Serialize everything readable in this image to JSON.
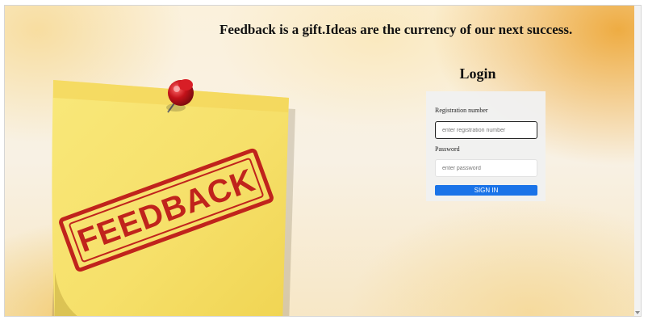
{
  "header": {
    "headline": "Feedback is a gift.Ideas are the currency of our next success."
  },
  "login": {
    "title": "Login",
    "registration_label": "Registration number",
    "registration_placeholder": "enter registration number",
    "registration_value": "",
    "password_label": "Password",
    "password_placeholder": "enter password",
    "password_value": "",
    "signin_label": "SIGN IN"
  },
  "illustration": {
    "stamp_text": "FEEDBACK",
    "note_color": "#f7e36a",
    "stamp_color": "#c0231c",
    "pin_color": "#c4121a"
  },
  "colors": {
    "accent": "#1a73e8"
  },
  "icons": {
    "pin": "pushpin-icon"
  }
}
